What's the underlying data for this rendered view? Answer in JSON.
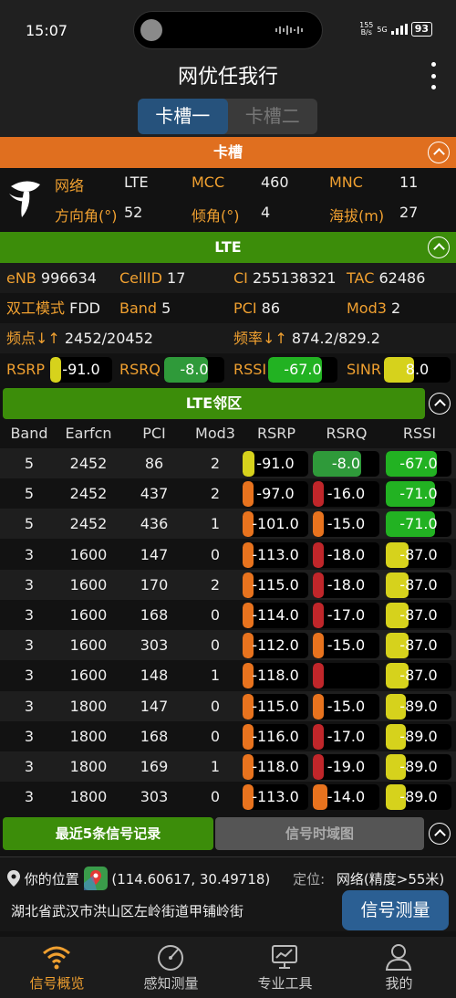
{
  "status": {
    "time": "15:07",
    "net_speed_top": "155",
    "net_speed_bottom": "B/s",
    "net_type": "5G",
    "battery": "93"
  },
  "app": {
    "title": "网优任我行"
  },
  "slots": {
    "tab1": "卡槽一",
    "tab2": "卡槽二"
  },
  "card_section": {
    "header": "卡槽",
    "network_label": "网络",
    "network": "LTE",
    "mcc_label": "MCC",
    "mcc": "460",
    "mnc_label": "MNC",
    "mnc": "11",
    "azimuth_label": "方向角(°)",
    "azimuth": "52",
    "tilt_label": "倾角(°)",
    "tilt": "4",
    "altitude_label": "海拔(m)",
    "altitude": "27"
  },
  "lte_section": {
    "header": "LTE",
    "enb_label": "eNB",
    "enb": "996634",
    "cellid_label": "CellID",
    "cellid": "17",
    "ci_label": "CI",
    "ci": "255138321",
    "tac_label": "TAC",
    "tac": "62486",
    "duplex_label": "双工模式",
    "duplex": "FDD",
    "band_label": "Band",
    "band": "5",
    "pci_label": "PCI",
    "pci": "86",
    "mod3_label": "Mod3",
    "mod3": "2",
    "freq_point_label": "频点↓↑",
    "freq_point": "2452/20452",
    "freq_label": "频率↓↑",
    "freq": "874.2/829.2",
    "rsrp_label": "RSRP",
    "rsrp": "-91.0",
    "rsrq_label": "RSRQ",
    "rsrq": "-8.0",
    "rssi_label": "RSSI",
    "rssi": "-67.0",
    "sinr_label": "SINR",
    "sinr": "8.0"
  },
  "meter_levels": {
    "rsrp": 0.18,
    "rsrq": 0.72,
    "rssi": 0.78,
    "sinr": 0.45
  },
  "neighbor_section": {
    "header": "LTE邻区",
    "columns": [
      "Band",
      "Earfcn",
      "PCI",
      "Mod3",
      "RSRP",
      "RSRQ",
      "RSSI"
    ],
    "rows": [
      {
        "band": "5",
        "earfcn": "2452",
        "pci": "86",
        "mod3": "2",
        "rsrp": "-91.0",
        "rsrq": "-8.0",
        "rssi": "-67.0",
        "rsrp_level": 0.18,
        "rsrp_color": "#d6d21c",
        "rsrq_level": 0.72,
        "rsrq_color": "#2f9a3a",
        "rssi_level": 0.78,
        "rssi_color": "#22b222"
      },
      {
        "band": "5",
        "earfcn": "2452",
        "pci": "437",
        "mod3": "2",
        "rsrp": "-97.0",
        "rsrq": "-16.0",
        "rssi": "-71.0",
        "rsrp_level": 0.12,
        "rsrp_color": "#e8731e",
        "rsrq_level": 0.08,
        "rsrq_color": "#c0262a",
        "rssi_level": 0.75,
        "rssi_color": "#22b222"
      },
      {
        "band": "5",
        "earfcn": "2452",
        "pci": "436",
        "mod3": "1",
        "rsrp": "-101.0",
        "rsrq": "-15.0",
        "rssi": "-71.0",
        "rsrp_level": 0.1,
        "rsrp_color": "#e8731e",
        "rsrq_level": 0.14,
        "rsrq_color": "#e8731e",
        "rssi_level": 0.75,
        "rssi_color": "#22b222"
      },
      {
        "band": "3",
        "earfcn": "1600",
        "pci": "147",
        "mod3": "0",
        "rsrp": "-113.0",
        "rsrq": "-18.0",
        "rssi": "-87.0",
        "rsrp_level": 0,
        "rsrp_color": "#e8731e",
        "rsrq_level": 0,
        "rsrq_color": "#c0262a",
        "rssi_level": 0.35,
        "rssi_color": "#d6d21c"
      },
      {
        "band": "3",
        "earfcn": "1600",
        "pci": "170",
        "mod3": "2",
        "rsrp": "-115.0",
        "rsrq": "-18.0",
        "rssi": "-87.0",
        "rsrp_level": 0,
        "rsrp_color": "#e8731e",
        "rsrq_level": 0,
        "rsrq_color": "#c0262a",
        "rssi_level": 0.35,
        "rssi_color": "#d6d21c"
      },
      {
        "band": "3",
        "earfcn": "1600",
        "pci": "168",
        "mod3": "0",
        "rsrp": "-114.0",
        "rsrq": "-17.0",
        "rssi": "-87.0",
        "rsrp_level": 0,
        "rsrp_color": "#e8731e",
        "rsrq_level": 0.06,
        "rsrq_color": "#c0262a",
        "rssi_level": 0.35,
        "rssi_color": "#d6d21c"
      },
      {
        "band": "3",
        "earfcn": "1600",
        "pci": "303",
        "mod3": "0",
        "rsrp": "-112.0",
        "rsrq": "-15.0",
        "rssi": "-87.0",
        "rsrp_level": 0,
        "rsrp_color": "#e8731e",
        "rsrq_level": 0.14,
        "rsrq_color": "#e8731e",
        "rssi_level": 0.35,
        "rssi_color": "#d6d21c"
      },
      {
        "band": "3",
        "earfcn": "1600",
        "pci": "148",
        "mod3": "1",
        "rsrp": "-118.0",
        "rsrq": "",
        "rssi": "-87.0",
        "rsrp_level": 0,
        "rsrp_color": "#e8731e",
        "rsrq_level": 0,
        "rsrq_color": "#c0262a",
        "rssi_level": 0.35,
        "rssi_color": "#d6d21c"
      },
      {
        "band": "3",
        "earfcn": "1800",
        "pci": "147",
        "mod3": "0",
        "rsrp": "-115.0",
        "rsrq": "-15.0",
        "rssi": "-89.0",
        "rsrp_level": 0,
        "rsrp_color": "#e8731e",
        "rsrq_level": 0.14,
        "rsrq_color": "#e8731e",
        "rssi_level": 0.3,
        "rssi_color": "#d6d21c"
      },
      {
        "band": "3",
        "earfcn": "1800",
        "pci": "168",
        "mod3": "0",
        "rsrp": "-116.0",
        "rsrq": "-17.0",
        "rssi": "-89.0",
        "rsrp_level": 0,
        "rsrp_color": "#e8731e",
        "rsrq_level": 0.06,
        "rsrq_color": "#c0262a",
        "rssi_level": 0.3,
        "rssi_color": "#d6d21c"
      },
      {
        "band": "3",
        "earfcn": "1800",
        "pci": "169",
        "mod3": "1",
        "rsrp": "-118.0",
        "rsrq": "-19.0",
        "rssi": "-89.0",
        "rsrp_level": 0,
        "rsrp_color": "#e8731e",
        "rsrq_level": 0,
        "rsrq_color": "#c0262a",
        "rssi_level": 0.3,
        "rssi_color": "#d6d21c"
      },
      {
        "band": "3",
        "earfcn": "1800",
        "pci": "303",
        "mod3": "0",
        "rsrp": "-113.0",
        "rsrq": "-14.0",
        "rssi": "-89.0",
        "rsrp_level": 0,
        "rsrp_color": "#e8731e",
        "rsrq_level": 0.22,
        "rsrq_color": "#e8731e",
        "rssi_level": 0.3,
        "rssi_color": "#d6d21c"
      }
    ]
  },
  "records": {
    "tab_recent": "最近5条信号记录",
    "tab_timeline": "信号时域图"
  },
  "location": {
    "label": "你的位置",
    "coords": "(114.60617, 30.49718)",
    "locate_label": "定位:",
    "locate_value": "网络(精度>55米)",
    "address": "湖北省武汉市洪山区左岭街道甲铺岭街",
    "measure_button": "信号测量"
  },
  "nav": {
    "overview": "信号概览",
    "sense": "感知测量",
    "tools": "专业工具",
    "mine": "我的"
  },
  "colors": {
    "accent_orange": "#e06f1f",
    "section_green": "#3c8d0a",
    "button_blue": "#2b5f93",
    "active_nav": "#f0a030"
  }
}
